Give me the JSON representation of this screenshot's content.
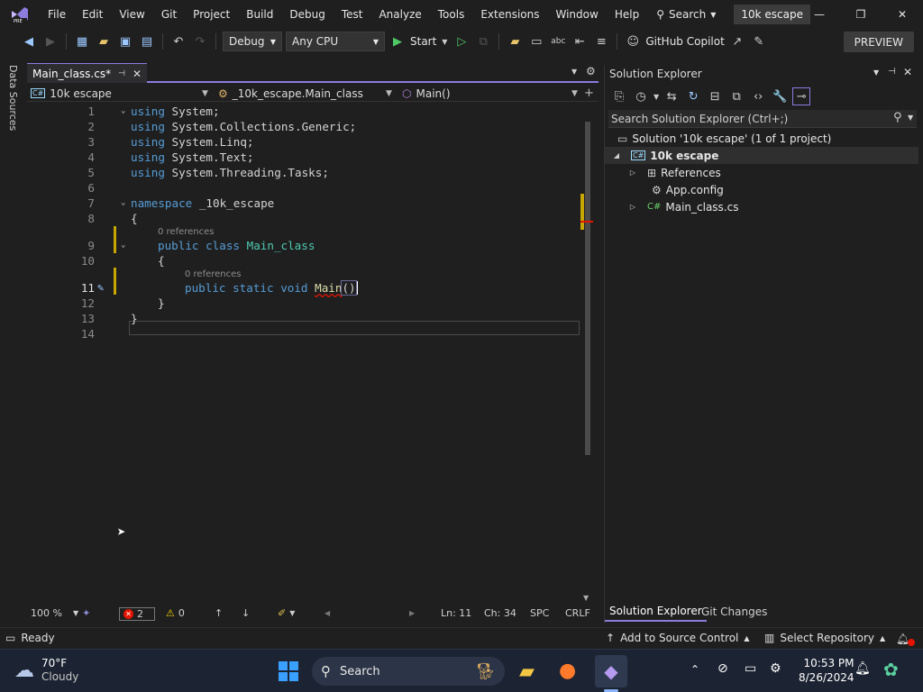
{
  "menubar": {
    "items": [
      "File",
      "Edit",
      "View",
      "Git",
      "Project",
      "Build",
      "Debug",
      "Test",
      "Analyze",
      "Tools",
      "Extensions",
      "Window",
      "Help"
    ],
    "search_label": "Search",
    "solution_title": "10k escape"
  },
  "toolbar": {
    "config": "Debug",
    "platform": "Any CPU",
    "start_label": "Start",
    "copilot_label": "GitHub Copilot",
    "preview_label": "PREVIEW"
  },
  "sidestrip": {
    "label": "Data Sources"
  },
  "editor": {
    "tab_label": "Main_class.cs*",
    "nav": {
      "project": "10k escape",
      "class": "_10k_escape.Main_class",
      "member": "Main()"
    },
    "lines": [
      {
        "n": "1"
      },
      {
        "n": "2"
      },
      {
        "n": "3"
      },
      {
        "n": "4"
      },
      {
        "n": "5"
      },
      {
        "n": "6"
      },
      {
        "n": "7"
      },
      {
        "n": "8"
      },
      {
        "n": "9"
      },
      {
        "n": "10"
      },
      {
        "n": "11"
      },
      {
        "n": "12"
      },
      {
        "n": "13"
      },
      {
        "n": "14"
      }
    ],
    "code": {
      "using_kw": "using",
      "u1": "System;",
      "u2": "System.Collections.Generic;",
      "u3": "System.Linq;",
      "u4": "System.Text;",
      "u5": "System.Threading.Tasks;",
      "namespace_kw": "namespace",
      "namespace_name": "_10k_escape",
      "brace_open": "{",
      "brace_close": "}",
      "public_kw": "public",
      "class_kw": "class",
      "class_name": "Main_class",
      "static_kw": "static",
      "void_kw": "void",
      "method_name": "Main",
      "parens": "()"
    },
    "lens_class": "0 references",
    "lens_method": "0 references",
    "status": {
      "zoom": "100 %",
      "errors": "2",
      "warnings": "0",
      "line": "Ln: 11",
      "col": "Ch: 34",
      "spacing": "SPC",
      "eol": "CRLF"
    }
  },
  "solution_explorer": {
    "title": "Solution Explorer",
    "search_placeholder": "Search Solution Explorer (Ctrl+;)",
    "solution_row": "Solution '10k escape' (1 of 1 project)",
    "project_row": "10k escape",
    "items": [
      "References",
      "App.config",
      "Main_class.cs"
    ],
    "tabs": [
      "Solution Explorer",
      "Git Changes"
    ]
  },
  "statusbar": {
    "ready": "Ready",
    "source_control": "Add to Source Control",
    "repository": "Select Repository"
  },
  "taskbar": {
    "weather_temp": "70°F",
    "weather_desc": "Cloudy",
    "search_label": "Search",
    "time": "10:53 PM",
    "date": "8/26/2024"
  },
  "colors": {
    "accent": "#8b7cde",
    "keyword": "#569cd6",
    "class_type": "#4ec9b0",
    "method": "#dcdcaa",
    "error": "#e51400"
  }
}
